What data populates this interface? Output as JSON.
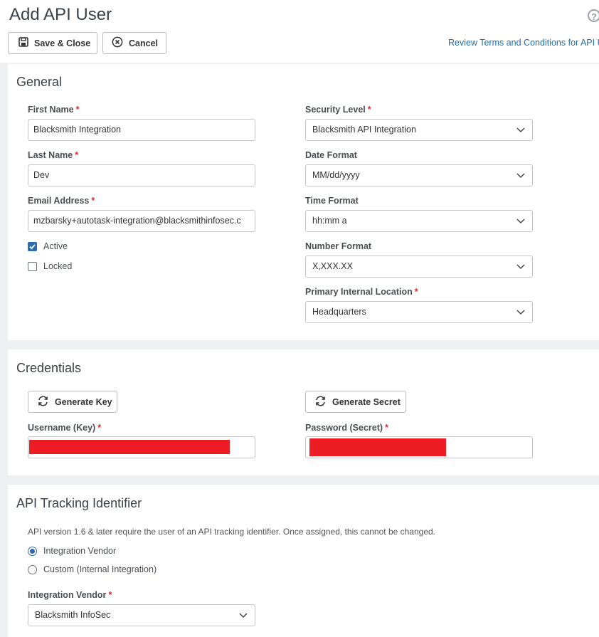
{
  "header": {
    "title": "Add API User",
    "save_close_label": "Save & Close",
    "cancel_label": "Cancel",
    "terms_link": "Review Terms and Conditions for API Us",
    "help_glyph": "?"
  },
  "general": {
    "title": "General",
    "first_name": {
      "label": "First Name",
      "value": "Blacksmith Integration"
    },
    "last_name": {
      "label": "Last Name",
      "value": "Dev"
    },
    "email": {
      "label": "Email Address",
      "value": "mzbarsky+autotask-integration@blacksmithinfosec.c"
    },
    "active": {
      "label": "Active",
      "checked": true
    },
    "locked": {
      "label": "Locked",
      "checked": false
    },
    "security_level": {
      "label": "Security Level",
      "value": "Blacksmith API Integration"
    },
    "date_format": {
      "label": "Date Format",
      "value": "MM/dd/yyyy"
    },
    "time_format": {
      "label": "Time Format",
      "value": "hh:mm a"
    },
    "number_format": {
      "label": "Number Format",
      "value": "X,XXX.XX"
    },
    "primary_location": {
      "label": "Primary Internal Location",
      "value": "Headquarters"
    }
  },
  "credentials": {
    "title": "Credentials",
    "generate_key_label": "Generate Key",
    "generate_secret_label": "Generate Secret",
    "username_label": "Username (Key)",
    "password_label": "Password (Secret)",
    "redaction_color": "#ee1c24"
  },
  "tracking": {
    "title": "API Tracking Identifier",
    "note": "API version 1.6 & later require the user of an API tracking identifier. Once assigned, this cannot be changed.",
    "option_vendor": "Integration Vendor",
    "option_custom": "Custom (Internal Integration)",
    "selected_option": "Integration Vendor",
    "vendor_label": "Integration Vendor",
    "vendor_value": "Blacksmith InfoSec"
  },
  "required_marker": "*",
  "colors": {
    "link": "#1b6fb5",
    "required": "#d32f2f",
    "accent": "#2d6cb0"
  }
}
